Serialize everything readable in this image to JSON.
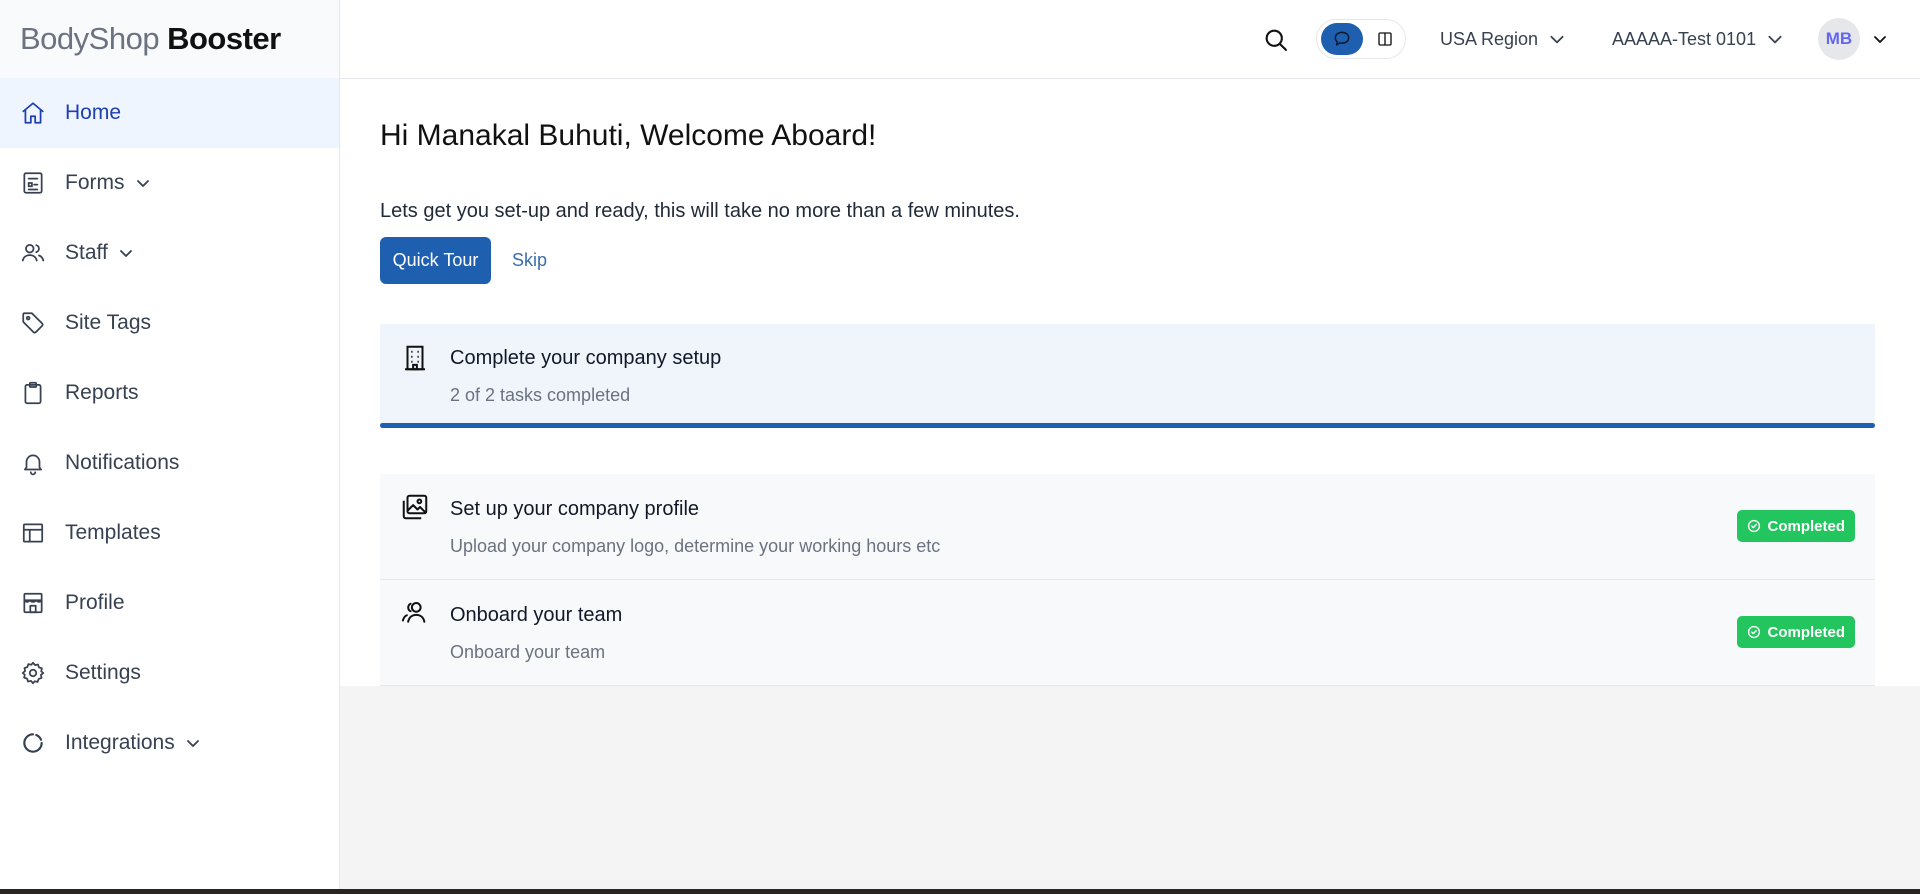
{
  "brand": {
    "light": "BodyShop",
    "bold": "Booster"
  },
  "sidebar": {
    "items": [
      {
        "label": "Home",
        "icon": "home-icon",
        "active": true
      },
      {
        "label": "Forms",
        "icon": "form-icon",
        "expandable": true
      },
      {
        "label": "Staff",
        "icon": "users-icon",
        "expandable": true
      },
      {
        "label": "Site Tags",
        "icon": "tag-icon"
      },
      {
        "label": "Reports",
        "icon": "clipboard-icon"
      },
      {
        "label": "Notifications",
        "icon": "bell-icon"
      },
      {
        "label": "Templates",
        "icon": "layout-icon"
      },
      {
        "label": "Profile",
        "icon": "store-icon"
      },
      {
        "label": "Settings",
        "icon": "gear-icon"
      },
      {
        "label": "Integrations",
        "icon": "loader-icon",
        "expandable": true
      }
    ]
  },
  "topbar": {
    "region": "USA Region",
    "account": "AAAAA-Test 0101",
    "avatar_initials": "MB"
  },
  "main": {
    "greeting": "Hi Manakal Buhuti, Welcome Aboard!",
    "subtitle": "Lets get you set-up and ready, this will take no more than a few minutes.",
    "quick_tour_label": "Quick Tour",
    "skip_label": "Skip",
    "setup": {
      "title": "Complete your company setup",
      "progress_text": "2 of 2 tasks completed",
      "progress_fraction": 1.0
    },
    "tasks": [
      {
        "title": "Set up your company profile",
        "description": "Upload your company logo, determine your working hours etc",
        "status": "Completed",
        "icon": "image-gallery-icon"
      },
      {
        "title": "Onboard your team",
        "description": "Onboard your team",
        "status": "Completed",
        "icon": "users-icon"
      }
    ]
  },
  "colors": {
    "primary": "#1f5fb0",
    "success": "#22c55e",
    "active_nav_bg": "#eef5ff",
    "avatar_text": "#6366f1"
  }
}
